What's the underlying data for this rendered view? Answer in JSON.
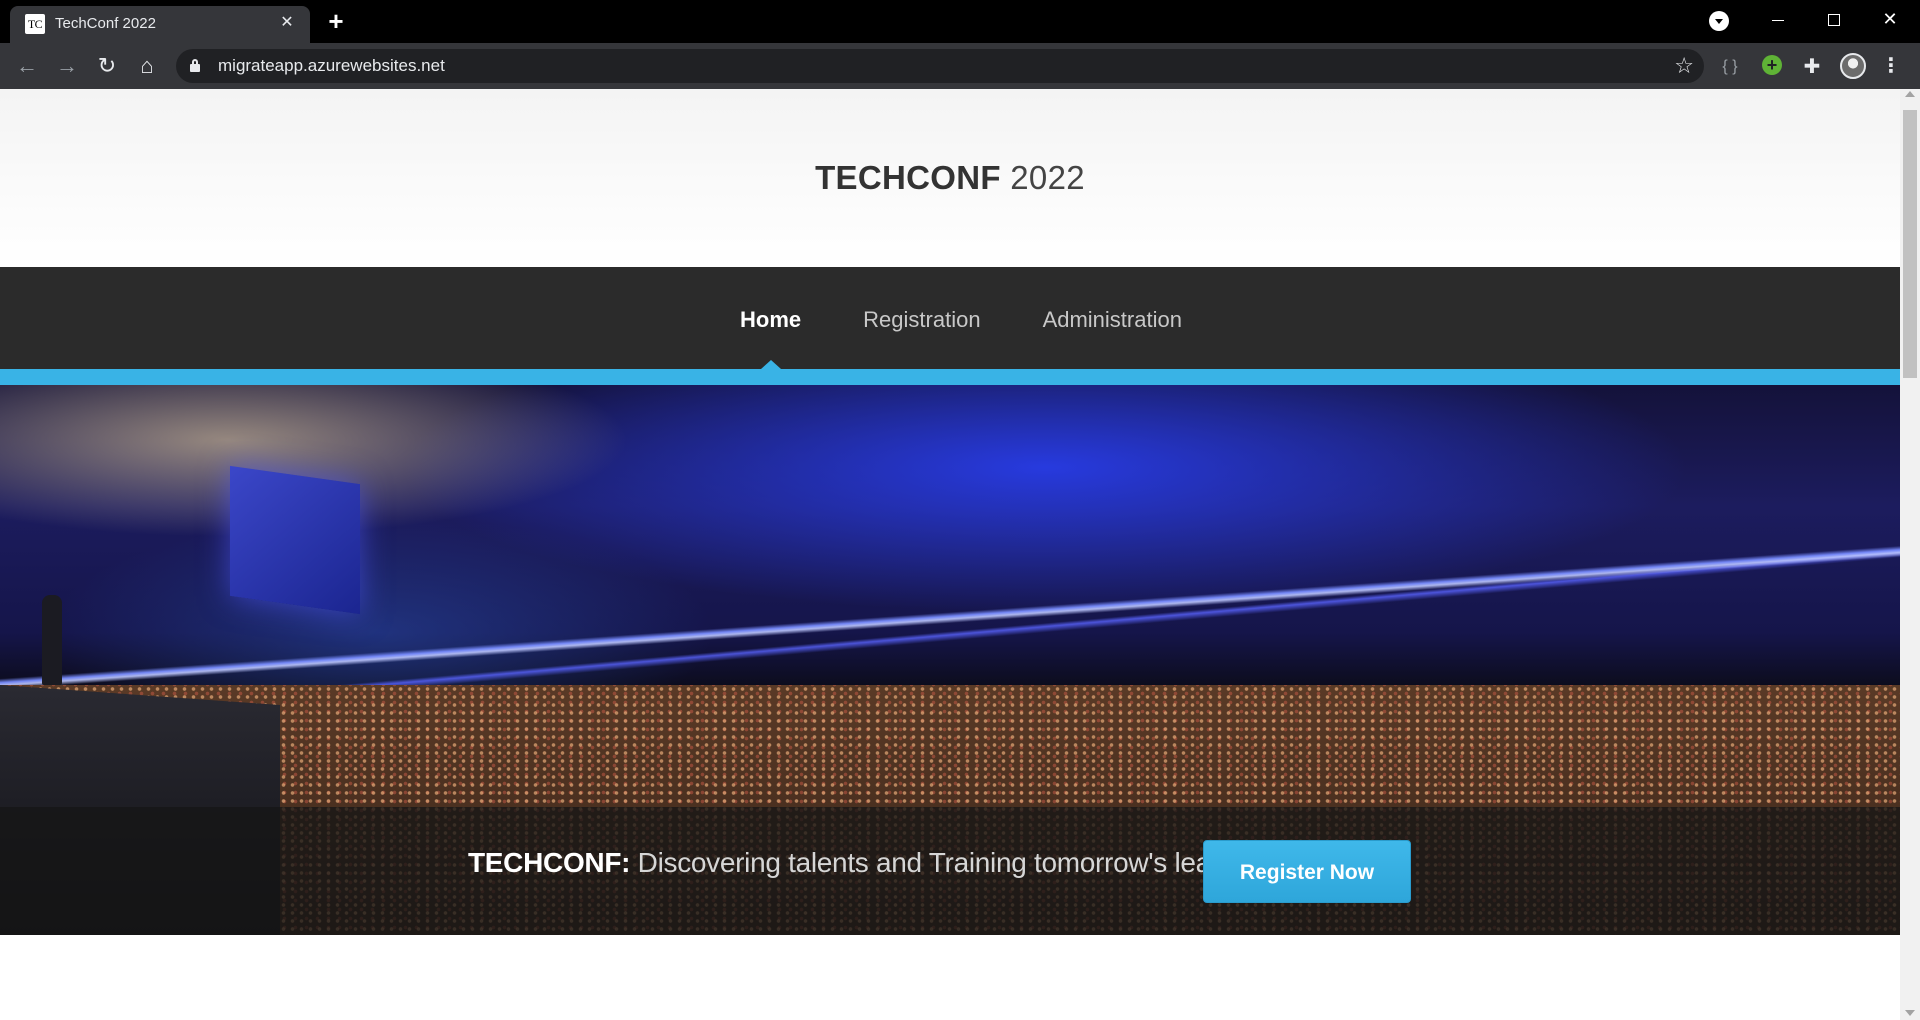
{
  "browser": {
    "tab_favicon": "TC",
    "tab_title": "TechConf 2022",
    "tab_close_icon": "✕",
    "new_tab_icon": "+",
    "url": "migrateapp.azurewebsites.net",
    "icons": {
      "back": "←",
      "forward": "→",
      "reload": "↻",
      "home": "⌂",
      "star": "☆",
      "braces": "{ }",
      "green_ext": "+",
      "puzzle": "✚",
      "menu": "⋮",
      "close": "✕"
    }
  },
  "site": {
    "logo_brand": "TECHCONF",
    "logo_year": "2022",
    "nav": [
      {
        "label": "Home",
        "active": true
      },
      {
        "label": "Registration",
        "active": false
      },
      {
        "label": "Administration",
        "active": false
      }
    ],
    "hero": {
      "tagline_brand": "TECHCONF:",
      "tagline_text": "Discovering talents and Training tomorrow's leaders",
      "cta_label": "Register Now"
    },
    "colors": {
      "accent": "#39b3e6",
      "nav_background": "#2b2b2b"
    }
  }
}
